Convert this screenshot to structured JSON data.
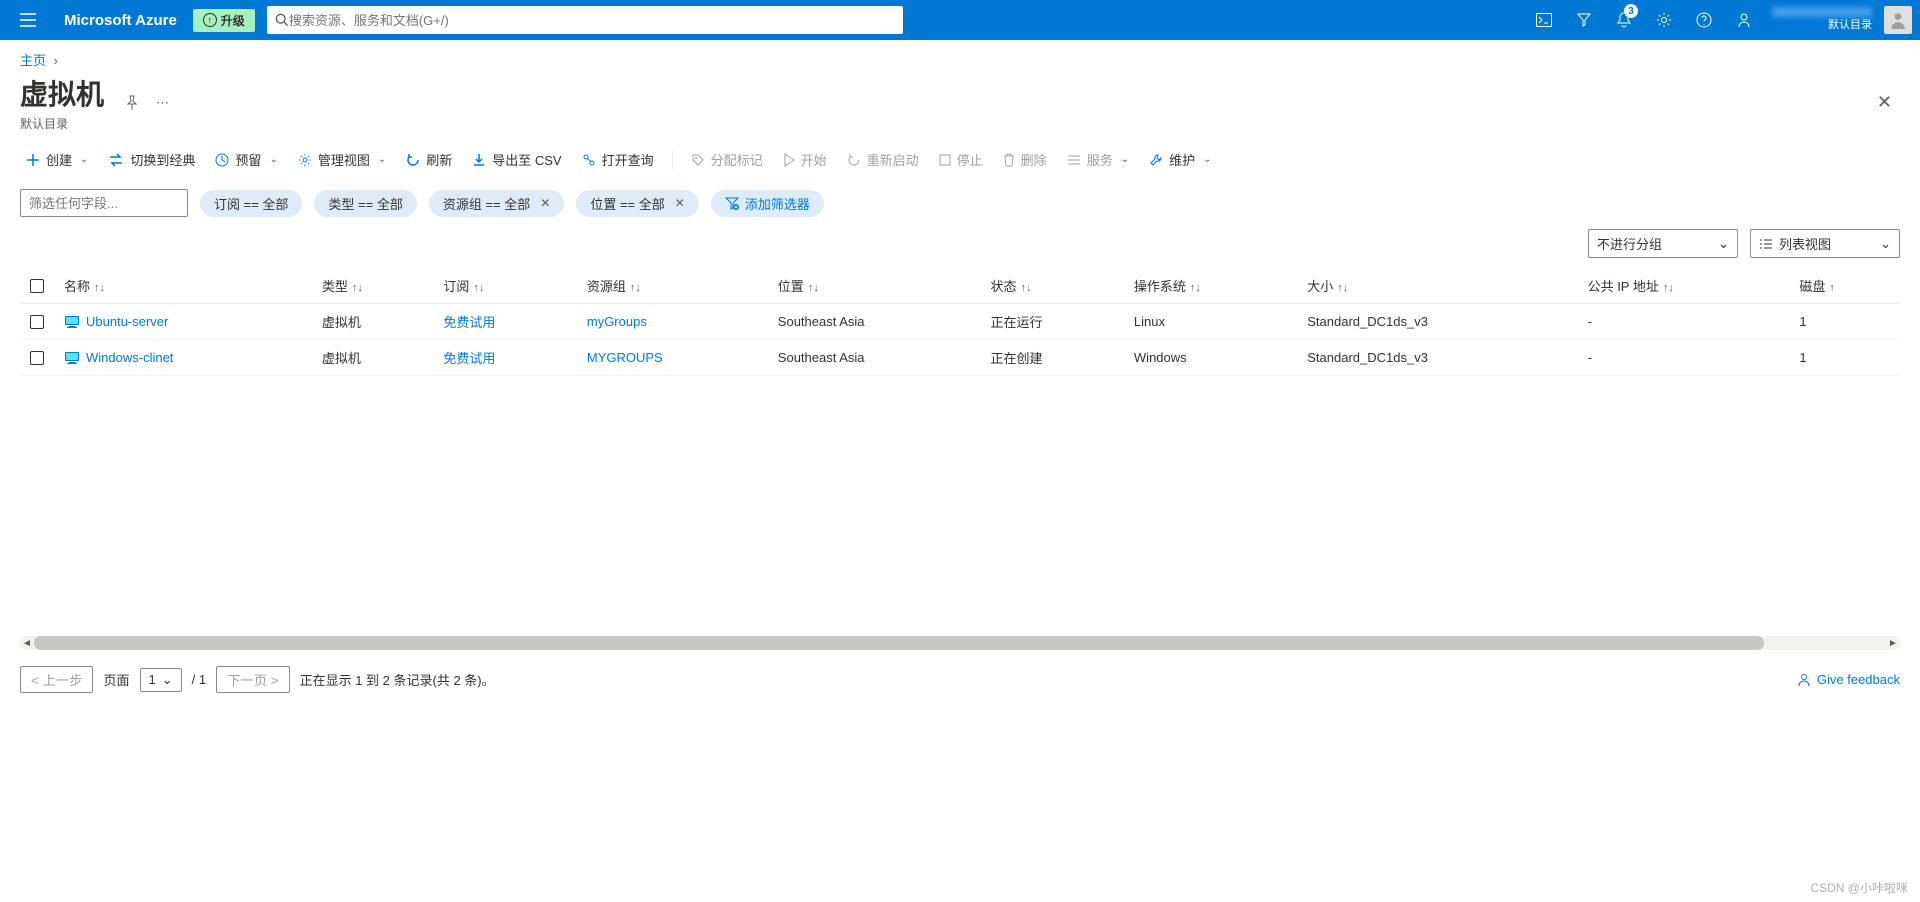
{
  "header": {
    "brand": "Microsoft Azure",
    "upgrade": "升级",
    "search_placeholder": "搜索资源、服务和文档(G+/)",
    "notification_count": "3",
    "directory": "默认目录"
  },
  "breadcrumb": {
    "home": "主页"
  },
  "page": {
    "title": "虚拟机",
    "subtitle": "默认目录"
  },
  "toolbar": {
    "create": "创建",
    "switch_classic": "切换到经典",
    "reserve": "预留",
    "manage_view": "管理视图",
    "refresh": "刷新",
    "export_csv": "导出至 CSV",
    "open_query": "打开查询",
    "assign_tags": "分配标记",
    "start": "开始",
    "restart": "重新启动",
    "stop": "停止",
    "delete": "删除",
    "services": "服务",
    "maintenance": "维护"
  },
  "filters": {
    "input_placeholder": "筛选任何字段...",
    "subscription": "订阅 == 全部",
    "type": "类型 == 全部",
    "resource_group": "资源组 == 全部",
    "location": "位置 == 全部",
    "add": "添加筛选器"
  },
  "view": {
    "group": "不进行分组",
    "layout": "列表视图"
  },
  "columns": {
    "name": "名称",
    "type": "类型",
    "subscription": "订阅",
    "resource_group": "资源组",
    "location": "位置",
    "status": "状态",
    "os": "操作系统",
    "size": "大小",
    "public_ip": "公共 IP 地址",
    "disks": "磁盘"
  },
  "rows": [
    {
      "name": "Ubuntu-server",
      "type": "虚拟机",
      "subscription": "免费试用",
      "resource_group": "myGroups",
      "location": "Southeast Asia",
      "status": "正在运行",
      "os": "Linux",
      "size": "Standard_DC1ds_v3",
      "public_ip": "-",
      "disks": "1"
    },
    {
      "name": "Windows-clinet",
      "type": "虚拟机",
      "subscription": "免费试用",
      "resource_group": "MYGROUPS",
      "location": "Southeast Asia",
      "status": "正在创建",
      "os": "Windows",
      "size": "Standard_DC1ds_v3",
      "public_ip": "-",
      "disks": "1"
    }
  ],
  "pager": {
    "prev": "< 上一步",
    "page_label": "页面",
    "page": "1",
    "total_pages": "/ 1",
    "next": "下一页 >",
    "summary": "正在显示 1 到 2 条记录(共 2 条)。",
    "feedback": "Give feedback"
  },
  "watermark": "CSDN @小咔啦咪"
}
